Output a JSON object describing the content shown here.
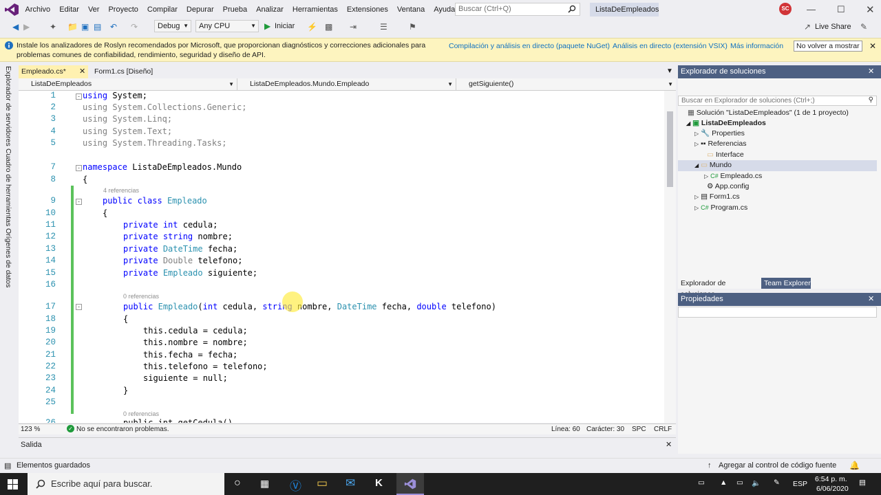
{
  "menu": [
    "Archivo",
    "Editar",
    "Ver",
    "Proyecto",
    "Compilar",
    "Depurar",
    "Prueba",
    "Analizar",
    "Herramientas",
    "Extensiones",
    "Ventana",
    "Ayuda"
  ],
  "search_placeholder": "Buscar (Ctrl+Q)",
  "solution_title": "ListaDeEmpleados",
  "user_initials": "SC",
  "toolbar": {
    "config": "Debug",
    "platform": "Any CPU",
    "start": "Iniciar",
    "live_share": "Live Share"
  },
  "info": {
    "text": "Instale los analizadores de Roslyn recomendados por Microsoft, que proporcionan diagnósticos y correcciones adicionales para problemas comunes de confiabilidad, rendimiento, seguridad y diseño de API.",
    "link1": "Compilación y análisis en directo (paquete NuGet)",
    "link2": "Análisis en directo (extensión VSIX)",
    "link3": "Más información",
    "button": "No volver a mostrar"
  },
  "left_strip": [
    "Explorador de servidores",
    "Cuadro de herramientas",
    "Orígenes de datos"
  ],
  "tabs": [
    "Empleado.cs*",
    "Form1.cs [Diseño]"
  ],
  "nav": [
    "ListaDeEmpleados",
    "ListaDeEmpleados.Mundo.Empleado",
    "getSiguiente()"
  ],
  "code": {
    "l1": "1",
    "l2": "2",
    "l3": "3",
    "l4": "4",
    "l5": "5",
    "l7": "7",
    "l8": "8",
    "l9": "9",
    "l10": "10",
    "l11": "11",
    "l12": "12",
    "l13": "13",
    "l14": "14",
    "l15": "15",
    "l16": "16",
    "l17": "17",
    "l18": "18",
    "l19": "19",
    "l20": "20",
    "l21": "21",
    "l22": "22",
    "l23": "23",
    "l24": "24",
    "l25": "25",
    "l26": "26",
    "refs4": "4 referencias",
    "refs0": "0 referencias",
    "t_using": "using",
    "t_system": " System;",
    "t_gen": "using System.Collections.Generic;",
    "t_linq": "using System.Linq;",
    "t_text": "using System.Text;",
    "t_tasks": "using System.Threading.Tasks;",
    "t_ns": "namespace",
    "t_nsname": " ListaDeEmpleados.Mundo",
    "t_open": "{",
    "t_close": "}",
    "t_public": "public",
    "t_class": "class",
    "t_empleado": "Empleado",
    "t_private": "private",
    "t_int": "int",
    "t_string": "string",
    "t_double_kw": "double",
    "t_DateTime": "DateTime",
    "t_Double": "Double",
    "f_cedula": " cedula;",
    "f_nombre": " nombre;",
    "f_fecha": " fecha;",
    "f_telefono": " telefono;",
    "f_siguiente": " siguiente;",
    "ctor_p1": "(",
    "ctor_a1": " cedula, ",
    "ctor_a2": " nombre, ",
    "ctor_a3": " fecha, ",
    "ctor_a4": " telefono)",
    "b1": "this.cedula = cedula;",
    "b2": "this.nombre = nombre;",
    "b3": "this.fecha = fecha;",
    "b4": "this.telefono = telefono;",
    "b5": "siguiente = null;",
    "l26text": "public int getCedula()"
  },
  "editor_status": {
    "zoom": "123 %",
    "problems": "No se encontraron problemas.",
    "line": "Línea: 60",
    "char": "Carácter: 30",
    "spc": "SPC",
    "crlf": "CRLF"
  },
  "output_title": "Salida",
  "solution_explorer": {
    "title": "Explorador de soluciones",
    "search": "Buscar en Explorador de soluciones (Ctrl+;)",
    "items": [
      "Solución \"ListaDeEmpleados\" (1 de 1 proyecto)",
      "ListaDeEmpleados",
      "Properties",
      "Referencias",
      "Interface",
      "Mundo",
      "Empleado.cs",
      "App.config",
      "Form1.cs",
      "Program.cs"
    ],
    "tab1": "Explorador de soluciones",
    "tab2": "Team Explorer"
  },
  "properties_title": "Propiedades",
  "status": {
    "left": "Elementos guardados",
    "right": "Agregar al control de código fuente"
  },
  "taskbar": {
    "search": "Escribe aquí para buscar.",
    "lang": "ESP",
    "time": "6:54 p. m.",
    "date": "6/06/2020"
  }
}
